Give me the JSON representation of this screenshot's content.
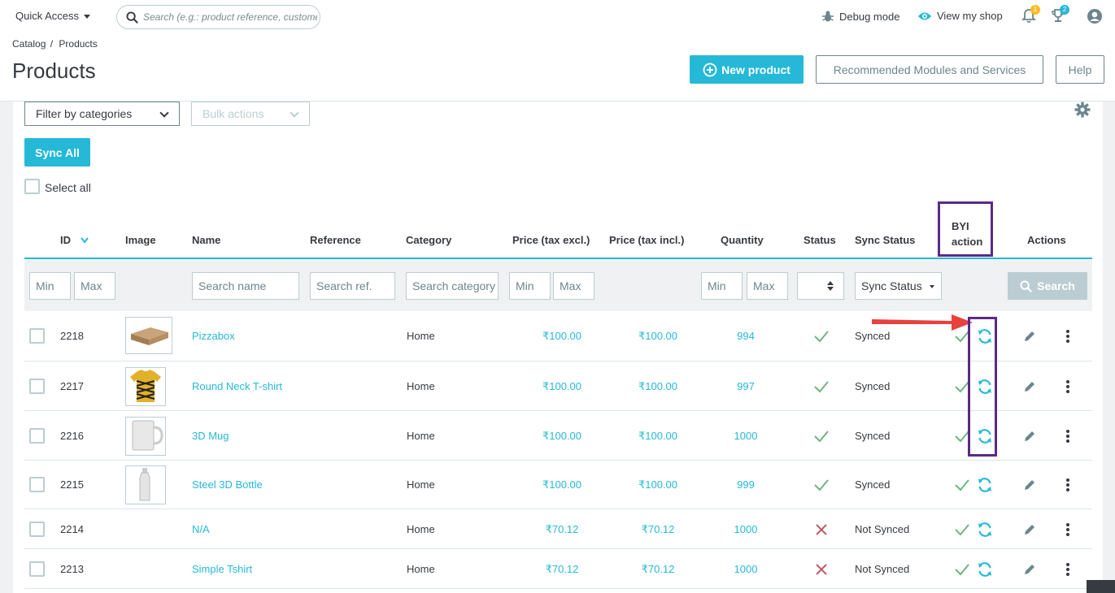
{
  "topbar": {
    "quick_access": "Quick Access",
    "search_placeholder": "Search (e.g.: product reference, customer name…)",
    "debug_mode": "Debug mode",
    "view_shop": "View my shop",
    "notifications_count": "1",
    "trophy_count": "2"
  },
  "header": {
    "breadcrumb_catalog": "Catalog",
    "breadcrumb_sep": "/",
    "breadcrumb_products": "Products",
    "title": "Products",
    "new_product": "New product",
    "recommended": "Recommended Modules and Services",
    "help": "Help"
  },
  "toolbar": {
    "filter_categories": "Filter by categories",
    "bulk_actions": "Bulk actions",
    "sync_all": "Sync All",
    "select_all": "Select all"
  },
  "columns": {
    "id": "ID",
    "image": "Image",
    "name": "Name",
    "reference": "Reference",
    "category": "Category",
    "price_excl": "Price (tax excl.)",
    "price_incl": "Price (tax incl.)",
    "quantity": "Quantity",
    "status": "Status",
    "sync_status": "Sync Status",
    "byi_line1": "BYI",
    "byi_line2": "action",
    "actions": "Actions"
  },
  "filters": {
    "min": "Min",
    "max": "Max",
    "search_name": "Search name",
    "search_ref": "Search ref.",
    "search_category": "Search category",
    "sync_status": "Sync Status",
    "search_button": "Search"
  },
  "rows": [
    {
      "id": "2218",
      "name": "Pizzabox",
      "category": "Home",
      "price_excl": "₹100.00",
      "price_incl": "₹100.00",
      "quantity": "994",
      "sync": "Synced",
      "status": "active"
    },
    {
      "id": "2217",
      "name": "Round Neck T-shirt",
      "category": "Home",
      "price_excl": "₹100.00",
      "price_incl": "₹100.00",
      "quantity": "997",
      "sync": "Synced",
      "status": "active"
    },
    {
      "id": "2216",
      "name": "3D Mug",
      "category": "Home",
      "price_excl": "₹100.00",
      "price_incl": "₹100.00",
      "quantity": "1000",
      "sync": "Synced",
      "status": "active"
    },
    {
      "id": "2215",
      "name": "Steel 3D Bottle",
      "category": "Home",
      "price_excl": "₹100.00",
      "price_incl": "₹100.00",
      "quantity": "999",
      "sync": "Synced",
      "status": "active"
    },
    {
      "id": "2214",
      "name": "N/A",
      "category": "Home",
      "price_excl": "₹70.12",
      "price_incl": "₹70.12",
      "quantity": "1000",
      "sync": "Not Synced",
      "status": "inactive"
    },
    {
      "id": "2213",
      "name": "Simple Tshirt",
      "category": "Home",
      "price_excl": "₹70.12",
      "price_incl": "₹70.12",
      "quantity": "1000",
      "sync": "Not Synced",
      "status": "inactive"
    }
  ],
  "colors": {
    "accent": "#25b9d7",
    "success": "#70b580",
    "danger": "#c05c67",
    "annotation_box": "#5b2a86",
    "annotation_arrow": "#e8423f"
  },
  "icons": [
    "search-icon",
    "bug-icon",
    "eye-icon",
    "bell-icon",
    "trophy-icon",
    "user-icon",
    "plus-circle-icon",
    "gear-icon",
    "check-icon",
    "cross-icon",
    "sync-icon",
    "pencil-icon",
    "kebab-icon",
    "sort-down-icon"
  ]
}
